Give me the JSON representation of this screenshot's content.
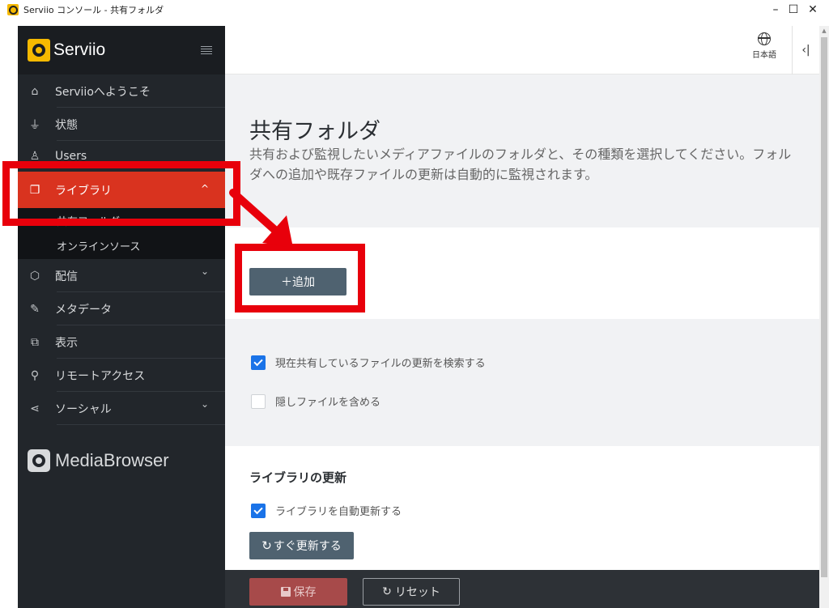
{
  "window": {
    "title": "Serviio コンソール - 共有フォルダ",
    "min_glyph": "–",
    "max_glyph": "☐",
    "close_glyph": "✕"
  },
  "sidebar": {
    "brand": "Serviio",
    "items": [
      {
        "label": "Serviioへようこそ",
        "icon": "home-icon",
        "glyph": "⌂"
      },
      {
        "label": "状態",
        "icon": "plug-icon",
        "glyph": "⏚"
      },
      {
        "label": "Users",
        "icon": "user-icon",
        "glyph": "♙"
      },
      {
        "label": "ライブラリ",
        "icon": "library-icon",
        "glyph": "❐",
        "active": true,
        "expanded": true
      },
      {
        "label": "配信",
        "icon": "box-icon",
        "glyph": "⬡"
      },
      {
        "label": "メタデータ",
        "icon": "edit-icon",
        "glyph": "✎"
      },
      {
        "label": "表示",
        "icon": "display-icon",
        "glyph": "⧉"
      },
      {
        "label": "リモートアクセス",
        "icon": "remote-icon",
        "glyph": "⚲"
      },
      {
        "label": "ソーシャル",
        "icon": "share-icon",
        "glyph": "⋖"
      }
    ],
    "library_sub": [
      {
        "label": "共有フォルダ",
        "current": true
      },
      {
        "label": "オンラインソース"
      }
    ],
    "chevron_up": "^",
    "chevron_down": "⌄",
    "media_browser": "MediaBrowser"
  },
  "header": {
    "language": "日本語",
    "panel_toggle": "‹|"
  },
  "main": {
    "title": "共有フォルダ",
    "description": "共有および監視したいメディアファイルのフォルダと、その種類を選択してください。フォルダへの追加や既存ファイルの更新は自動的に監視されます。",
    "add_button": "＋追加",
    "options": {
      "check_updates": {
        "label": "現在共有しているファイルの更新を検索する",
        "checked": true
      },
      "include_hidden": {
        "label": "隠しファイルを含める",
        "checked": false
      }
    },
    "library_update": {
      "title": "ライブラリの更新",
      "auto_update": {
        "label": "ライブラリを自動更新する",
        "checked": true
      },
      "refresh_icon": "↻",
      "refresh_button": "すぐ更新する"
    }
  },
  "footer": {
    "save_button": "保存",
    "reset_icon": "↻",
    "reset_button": "リセット"
  },
  "colors": {
    "sidebar_bg": "#22262b",
    "active_item": "#d9331f",
    "button_slate": "#4f6270",
    "save_button": "#a74a4a",
    "annotation_red": "#e8000b",
    "checkbox_blue": "#1a73e8"
  }
}
